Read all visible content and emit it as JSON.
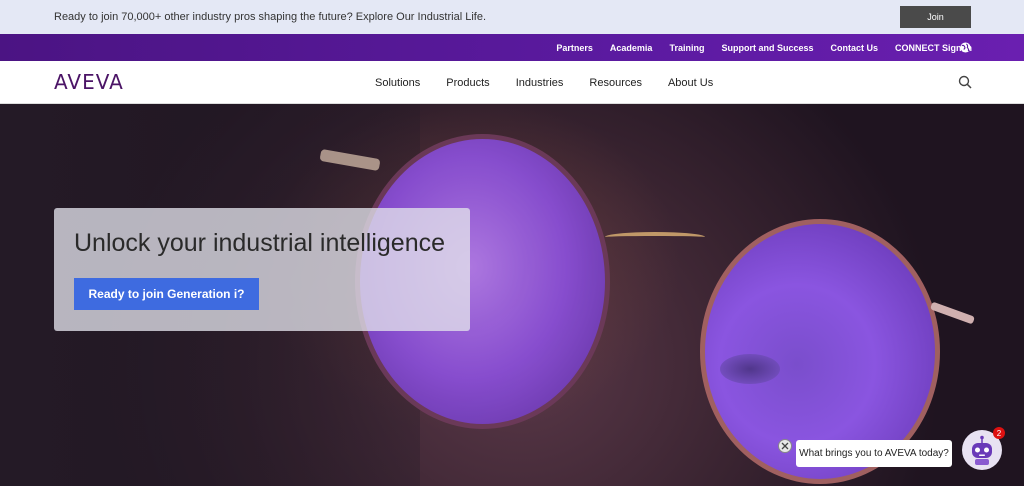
{
  "announcement": {
    "text": "Ready to join 70,000+ other industry pros shaping the future? Explore Our Industrial Life.",
    "join_label": "Join"
  },
  "utility_nav": {
    "items": [
      {
        "label": "Partners"
      },
      {
        "label": "Academia"
      },
      {
        "label": "Training"
      },
      {
        "label": "Support and Success"
      },
      {
        "label": "Contact Us"
      },
      {
        "label": "CONNECT Sign In"
      }
    ],
    "globe_icon": "globe-icon"
  },
  "main_nav": {
    "logo": "AVEVA",
    "items": [
      {
        "label": "Solutions"
      },
      {
        "label": "Products"
      },
      {
        "label": "Industries"
      },
      {
        "label": "Resources"
      },
      {
        "label": "About Us"
      }
    ],
    "search_icon": "search-icon"
  },
  "hero": {
    "title": "Unlock your industrial intelligence",
    "cta_label": "Ready to join Generation i?"
  },
  "chat": {
    "prompt": "What brings you to AVEVA today?",
    "badge_count": "2",
    "close_icon": "close-icon",
    "bot_icon": "robot-icon"
  },
  "colors": {
    "brand_purple": "#5b1aa0",
    "cta_blue": "#3e6be0",
    "join_gray": "#4a4a4a"
  }
}
